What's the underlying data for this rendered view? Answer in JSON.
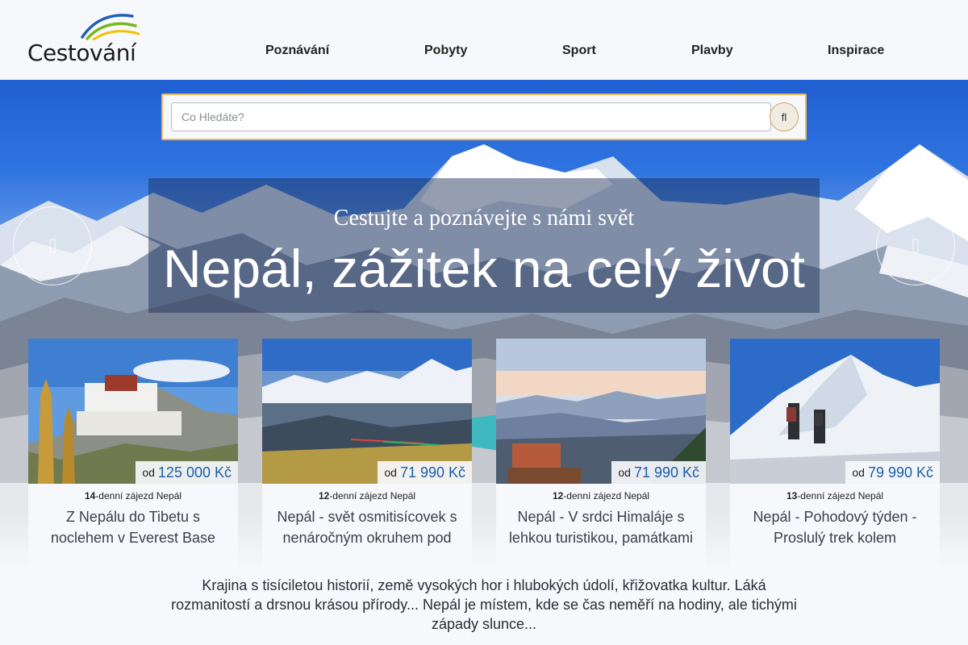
{
  "header": {
    "logo_text": "Cestování",
    "nav": [
      {
        "label": "Poznávání"
      },
      {
        "label": "Pobyty"
      },
      {
        "label": "Sport"
      },
      {
        "label": "Plavby"
      },
      {
        "label": "Inspirace"
      }
    ]
  },
  "search": {
    "placeholder": "Co Hledáte?",
    "button_icon": "search-icon",
    "button_glyph": "fl"
  },
  "hero": {
    "subtitle": "Cestujte a poznávejte s námi svět",
    "title": "Nepál, zážitek na celý život"
  },
  "cards": [
    {
      "duration_days": "14",
      "duration_suffix": "-denní zájezd Nepál",
      "price_prefix": "od",
      "price": "125 000 Kč",
      "title": "Z Nepálu do Tibetu s noclehem v Everest Base"
    },
    {
      "duration_days": "12",
      "duration_suffix": "-denní zájezd Nepál",
      "price_prefix": "od",
      "price": "71 990 Kč",
      "title": "Nepál - svět osmitisícovek s nenáročným okruhem pod"
    },
    {
      "duration_days": "12",
      "duration_suffix": "-denní zájezd Nepál",
      "price_prefix": "od",
      "price": "71 990 Kč",
      "title": "Nepál - V srdci Himaláje s lehkou turistikou, památkami"
    },
    {
      "duration_days": "13",
      "duration_suffix": "-denní zájezd Nepál",
      "price_prefix": "od",
      "price": "79 990 Kč",
      "title": "Nepál - Pohodový týden - Proslulý trek kolem"
    }
  ],
  "intro_text": "Krajina s tisíciletou historií, země vysokých hor i hlubokých údolí, křižovatka kultur. Láká rozmanitostí a drsnou krásou přírody... Nepál je místem, kde se čas neměří na hodiny, ale tichými západy slunce...",
  "colors": {
    "accent_border": "#f0b75a",
    "price": "#1a5ea8"
  }
}
